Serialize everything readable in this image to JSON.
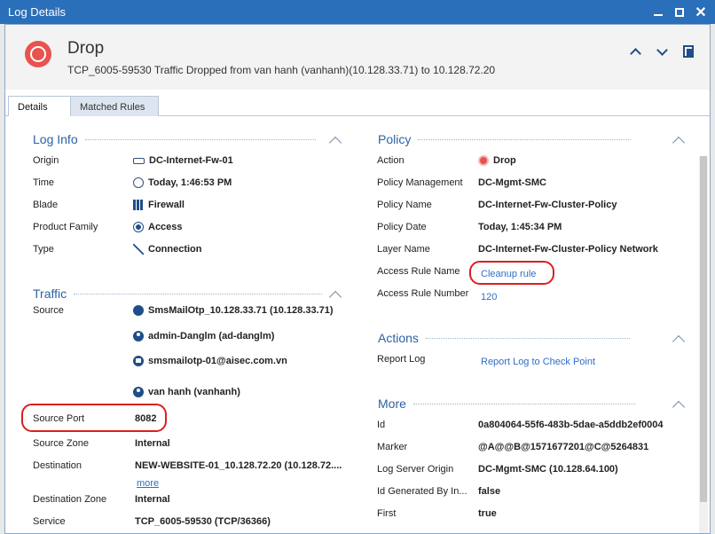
{
  "window": {
    "title": "Log Details"
  },
  "header": {
    "title": "Drop",
    "subtitle": "TCP_6005-59530 Traffic Dropped from van hanh (vanhanh)(10.128.33.71) to 10.128.72.20"
  },
  "tabs": [
    {
      "label": "Details",
      "active": true
    },
    {
      "label": "Matched Rules",
      "active": false
    }
  ],
  "log_info": {
    "title": "Log Info",
    "rows": [
      {
        "label": "Origin",
        "value": "DC-Internet-Fw-01",
        "icon": "gateway-icon"
      },
      {
        "label": "Time",
        "value": "Today, 1:46:53 PM",
        "icon": "clock-icon"
      },
      {
        "label": "Blade",
        "value": "Firewall",
        "icon": "firewall-icon"
      },
      {
        "label": "Product Family",
        "value": "Access",
        "icon": "access-icon"
      },
      {
        "label": "Type",
        "value": "Connection",
        "icon": "connection-icon"
      }
    ]
  },
  "traffic": {
    "title": "Traffic",
    "source_label": "Source",
    "source_values": [
      {
        "value": "SmsMailOtp_10.128.33.71 (10.128.33.71)",
        "icon": "globe-icon"
      },
      {
        "value": "admin-Danglm (ad-danglm)",
        "icon": "user-icon"
      },
      {
        "value": "smsmailotp-01@aisec.com.vn",
        "icon": "host-icon"
      },
      {
        "value": "van hanh (vanhanh)",
        "icon": "user-icon"
      }
    ],
    "rows": [
      {
        "label": "Source Port",
        "value": "8082"
      },
      {
        "label": "Source Zone",
        "value": "Internal"
      },
      {
        "label": "Destination",
        "value": "NEW-WEBSITE-01_10.128.72.20 (10.128.72...."
      },
      {
        "label": "Destination Zone",
        "value": "Internal"
      },
      {
        "label": "Service",
        "value": "TCP_6005-59530 (TCP/36366)"
      }
    ],
    "more_link": "more"
  },
  "policy": {
    "title": "Policy",
    "rows": [
      {
        "label": "Action",
        "value": "Drop",
        "icon": "drop-icon"
      },
      {
        "label": "Policy Management",
        "value": "DC-Mgmt-SMC"
      },
      {
        "label": "Policy Name",
        "value": "DC-Internet-Fw-Cluster-Policy"
      },
      {
        "label": "Policy Date",
        "value": "Today, 1:45:34 PM"
      },
      {
        "label": "Layer Name",
        "value": "DC-Internet-Fw-Cluster-Policy Network"
      },
      {
        "label": "Access Rule Name",
        "value": "Cleanup rule"
      },
      {
        "label": "Access Rule Number",
        "value": "120"
      }
    ]
  },
  "actions": {
    "title": "Actions",
    "rows": [
      {
        "label": "Report Log",
        "value": "Report Log to Check Point"
      }
    ]
  },
  "more": {
    "title": "More",
    "rows": [
      {
        "label": "Id",
        "value": "0a804064-55f6-483b-5dae-a5ddb2ef0004"
      },
      {
        "label": "Marker",
        "value": "@A@@B@1571677201@C@5264831"
      },
      {
        "label": "Log Server Origin",
        "value": "DC-Mgmt-SMC (10.128.64.100)"
      },
      {
        "label": "Id Generated By In...",
        "value": "false"
      },
      {
        "label": "First",
        "value": "true"
      }
    ]
  },
  "colors": {
    "titlebar": "#2a6fba",
    "section_title": "#2d62a3",
    "link": "#2e6fc9",
    "drop": "#e8534f",
    "highlight": "#d9201e"
  }
}
